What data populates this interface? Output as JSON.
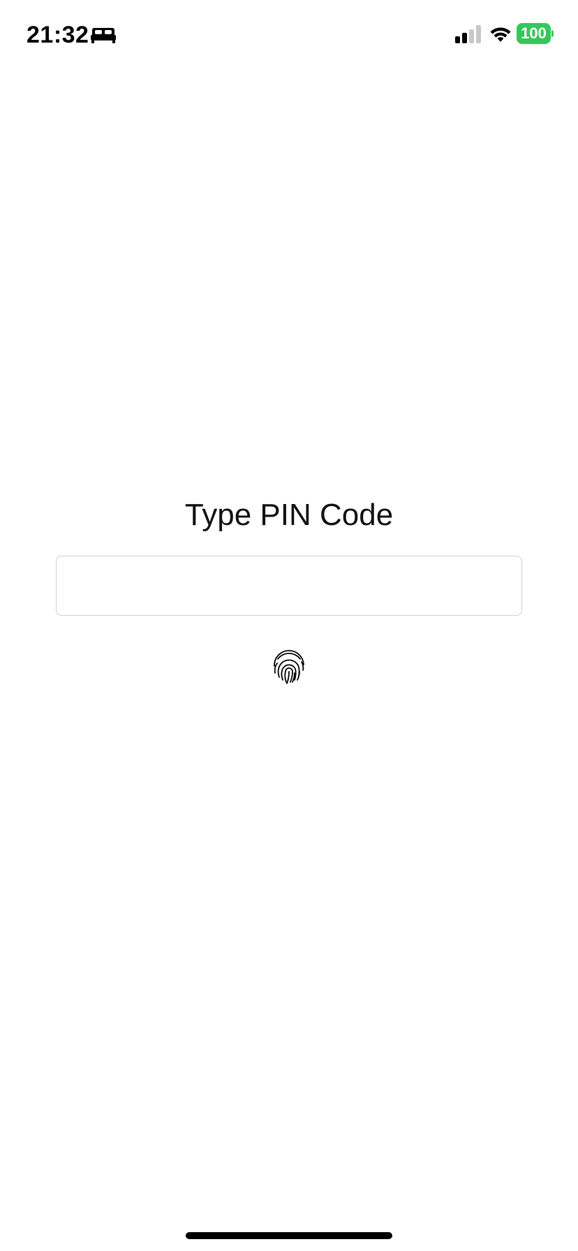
{
  "status_bar": {
    "time": "21:32",
    "sleep_icon": "bed-icon",
    "signal_icon": "cellular-signal-icon",
    "signal_bars_active": 2,
    "signal_bars_total": 4,
    "wifi_icon": "wifi-icon",
    "battery_level": "100",
    "battery_color": "#34c759"
  },
  "main": {
    "title": "Type PIN Code",
    "pin_input": {
      "value": "",
      "placeholder": ""
    },
    "biometric_icon": "fingerprint-icon"
  }
}
